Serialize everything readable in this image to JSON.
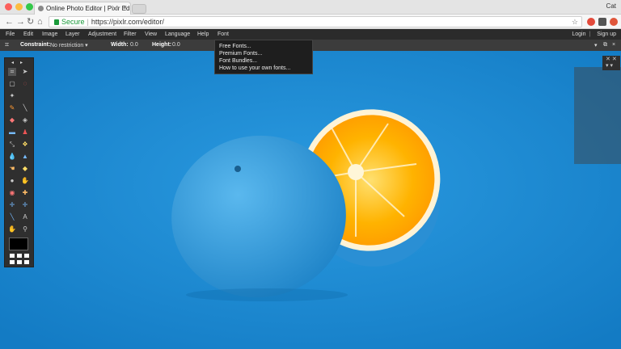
{
  "browser": {
    "tab_title": "Online Photo Editor | Pixlr Edi",
    "user_name": "Cat",
    "secure_label": "Secure",
    "url": "https://pixlr.com/editor/"
  },
  "menu": {
    "items": [
      "File",
      "Edit",
      "Image",
      "Layer",
      "Adjustment",
      "Filter",
      "View",
      "Language",
      "Help",
      "Font"
    ],
    "login": "Login",
    "signup": "Sign up"
  },
  "options": {
    "constraint_label": "Constraint:",
    "constraint_value": "No restriction",
    "width_label": "Width:",
    "width_value": "0.0",
    "height_label": "Height:",
    "height_value": "0.0"
  },
  "font_menu": {
    "items": [
      "Free Fonts...",
      "Premium Fonts...",
      "Font Bundles...",
      "How to use your own fonts..."
    ]
  },
  "toolbox": {
    "tools": [
      "crop-icon",
      "move-icon",
      "marquee-icon",
      "lasso-icon",
      "wand-icon",
      "pencil-icon",
      "brush-icon",
      "eraser-icon",
      "bucket-icon",
      "gradient-icon",
      "clone-icon",
      "color-replace-icon",
      "drawing-icon",
      "blur-icon",
      "sharpen-icon",
      "smudge-icon",
      "sponge-icon",
      "dodge-icon",
      "burn-icon",
      "red-eye-icon",
      "spot-heal-icon",
      "bloat-icon",
      "pinch-icon",
      "type-icon",
      "hand-icon",
      "zoom-icon"
    ]
  },
  "colors": {
    "canvas_bg": "#1d8fd8",
    "orange_flesh": "#ffb000",
    "menubar": "#2b2b2b"
  }
}
